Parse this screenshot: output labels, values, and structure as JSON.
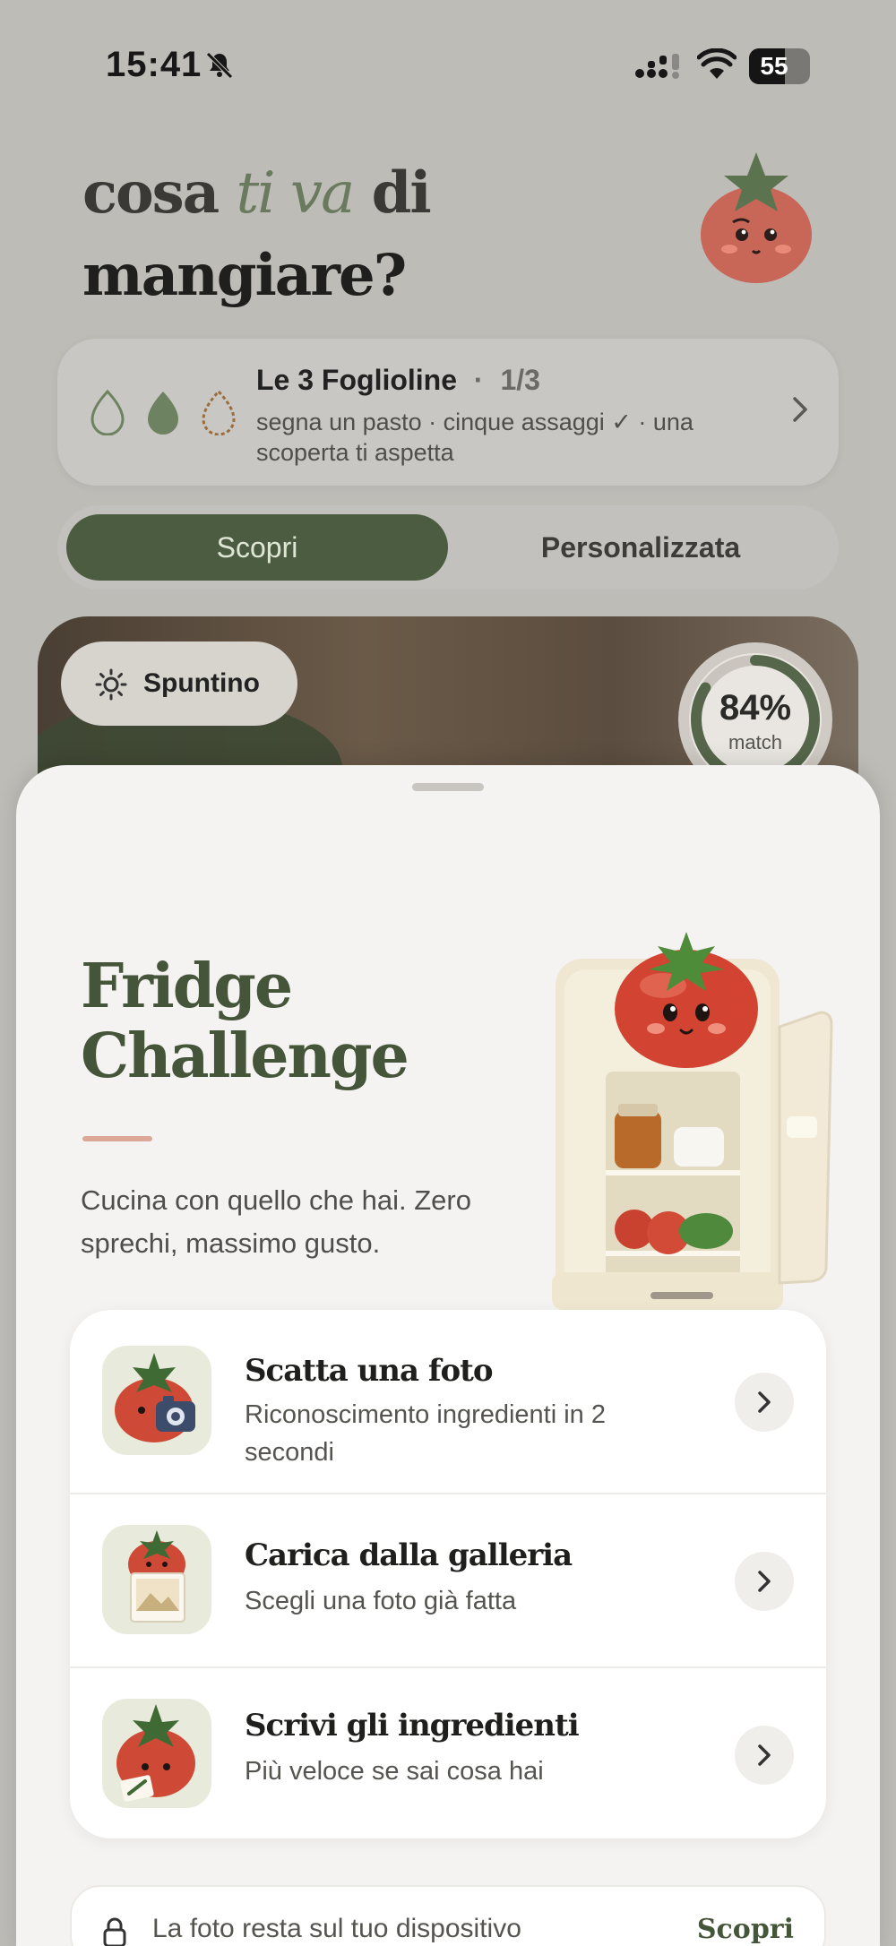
{
  "status_bar": {
    "time": "15:41",
    "battery": "55"
  },
  "header": {
    "line1_a": "cosa ",
    "line1_em": "ti va",
    "line1_b": " di",
    "line2": "mangiare?"
  },
  "leaves_card": {
    "title": "Le 3 Foglioline",
    "separator": "·",
    "progress": "1/3",
    "subtitle": "segna un pasto · cinque assaggi ✓ · una scoperta ti aspetta"
  },
  "tabs": [
    {
      "label": "Scopri",
      "active": true
    },
    {
      "label": "Personalizzata",
      "active": false
    }
  ],
  "hero": {
    "meal_label": "Spuntino",
    "match_percent": "84%",
    "match_label": "match",
    "match_value": 0.84
  },
  "sheet": {
    "title": "Fridge Challenge",
    "subtitle": "Cucina con quello che hai. Zero sprechi, massimo gusto.",
    "options": [
      {
        "title": "Scatta una foto",
        "subtitle": "Riconoscimento ingredienti in 2 secondi"
      },
      {
        "title": "Carica dalla galleria",
        "subtitle": "Scegli una foto già fatta"
      },
      {
        "title": "Scrivi gli ingredienti",
        "subtitle": "Più veloce se sai cosa hai"
      }
    ],
    "privacy": {
      "text": "La foto resta sul tuo dispositivo",
      "link": "Scopri"
    }
  },
  "colors": {
    "accent_green": "#4c5c40",
    "title_green": "#45553a",
    "tomato": "#d9533f",
    "accent_line": "#dba898"
  }
}
